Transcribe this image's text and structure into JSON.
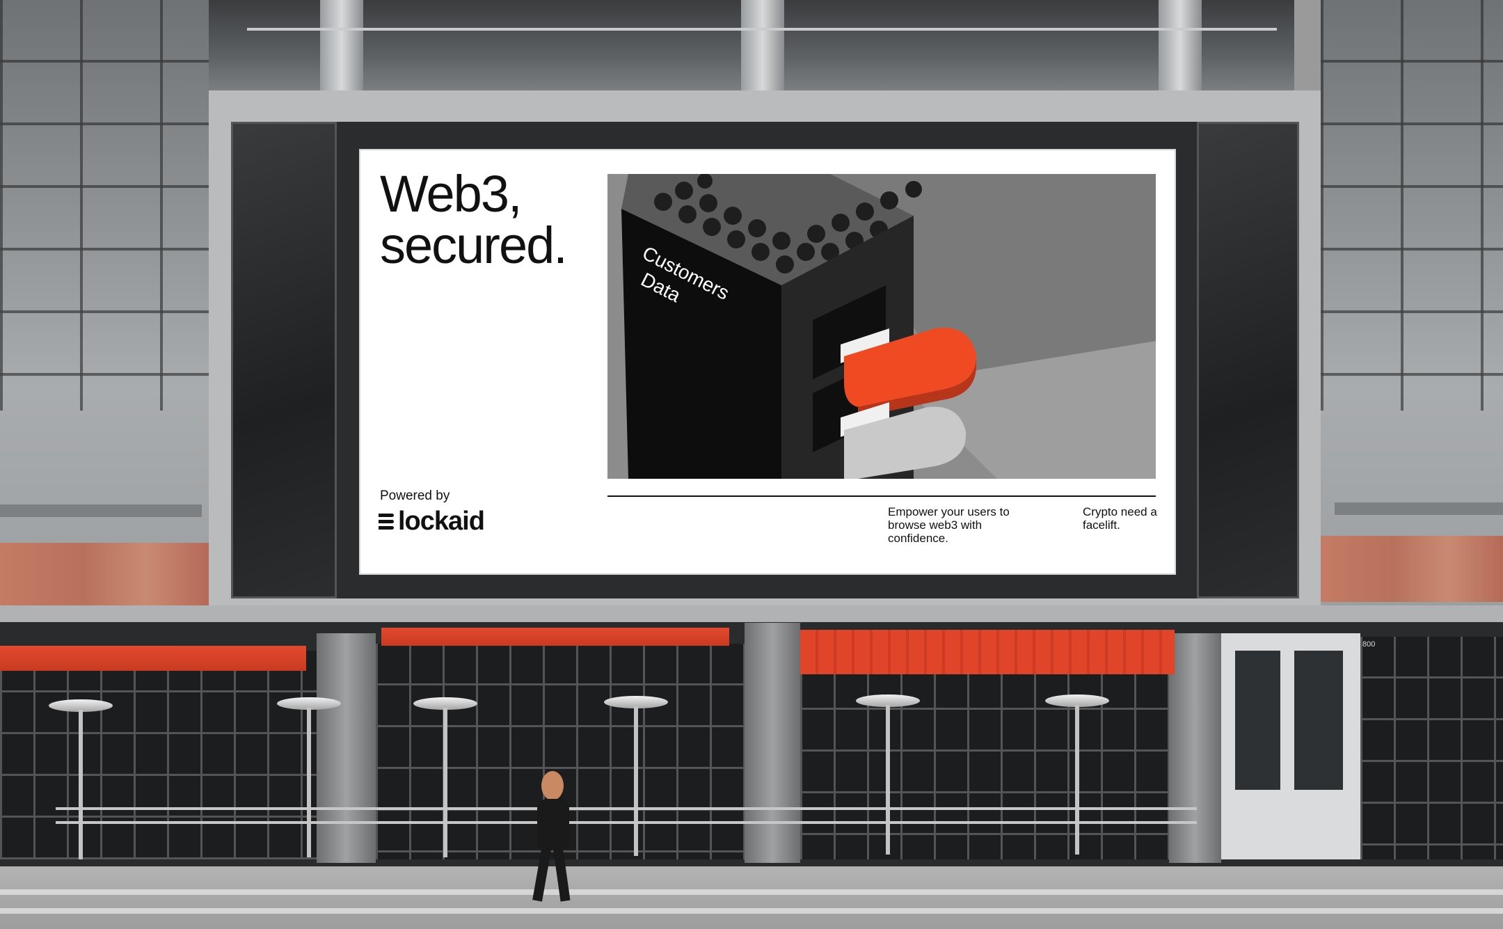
{
  "billboard": {
    "headline_line1": "Web3,",
    "headline_line2": "secured.",
    "powered_by": "Powered by",
    "brand": "lockaid",
    "illustration_label_line1": "Customers",
    "illustration_label_line2": "Data",
    "tagline_1": "Empower your users to browse web3 with confidence.",
    "tagline_2": "Crypto need a facelift."
  },
  "storefront": {
    "door_number": "800"
  },
  "colors": {
    "accent_orange": "#ef4a22",
    "board_white": "#ffffff",
    "ink": "#111111",
    "awning_red": "#e0452a"
  },
  "icons": {
    "brand_mark": "stacked-bars-logo",
    "usb_key_orange": "usb-key-orange",
    "usb_key_gray": "usb-key-dotted-gray"
  }
}
